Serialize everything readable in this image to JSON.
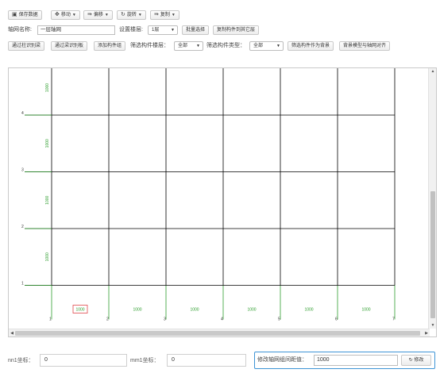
{
  "toolbar": {
    "save_label": "保存数据",
    "move_label": "移动",
    "offset_label": "偏移",
    "rotate_label": "旋转",
    "copy_label": "复制"
  },
  "axis_net": {
    "name_label": "轴网名称:",
    "name_value": "一层轴网",
    "floor_label": "设置楼层:",
    "floor_value": "1层",
    "batch_select_label": "批量选择",
    "copy_to_floor_label": "复制构件到其它层"
  },
  "filter": {
    "by_axis_label": "通过柱识别梁",
    "by_beam_label": "通过梁识别板",
    "add_group_label": "添加构件组",
    "floor_filter_label": "筛选构件楼层：",
    "floor_filter_value": "全部",
    "type_filter_label": "筛选构件类型：",
    "type_filter_value": "全部",
    "as_background_label": "筛选构件作为背景",
    "align_label": "背景模型与轴网对齐"
  },
  "grid": {
    "row_labels": [
      "4",
      "3",
      "2",
      "1"
    ],
    "row_spacings": [
      "1000",
      "1000",
      "1000",
      "1000"
    ],
    "col_labels": [
      "1",
      "2",
      "3",
      "4",
      "5",
      "6",
      "7"
    ],
    "col_spacings": [
      "1000",
      "1000",
      "1000",
      "1000",
      "1000",
      "1000"
    ],
    "selected_col_spacing_index": 0,
    "line_color": "#000000",
    "axis_color": "#2e9e2e",
    "selected_color": "#e0484b"
  },
  "footer": {
    "nn1_label": "nn1坐标：",
    "nn1_value": "0",
    "mm1_label": "mm1坐标：",
    "mm1_value": "0",
    "spacing_label": "修改轴网组间距值：",
    "spacing_value": "1000",
    "modify_label": "修改"
  }
}
